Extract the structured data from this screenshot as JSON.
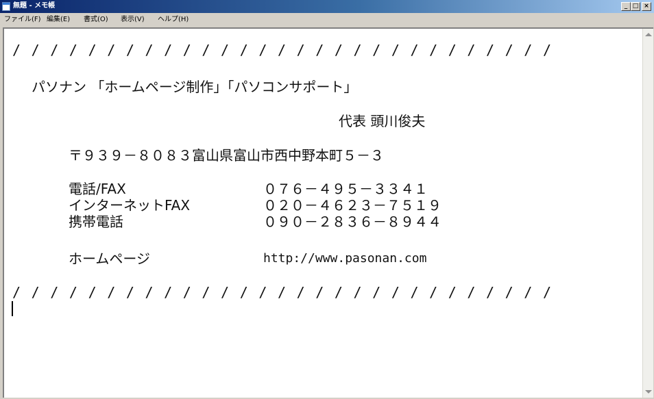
{
  "window": {
    "title": "無題 - メモ帳",
    "buttons": {
      "minimize": "_",
      "maximize": "□",
      "close": "×"
    }
  },
  "menu": [
    "ファイル(F)",
    "編集(E)",
    "書式(O)",
    "表示(V)",
    "ヘルプ(H)"
  ],
  "document": {
    "divider": "/////////////////////////////",
    "heading": "パソナン 「ホームページ制作」「パソコンサポート」",
    "representative": "代表 頭川俊夫",
    "address": "〒９３９－８０８３富山県富山市西中野本町５－３",
    "contacts": [
      {
        "label": "電話/FAX",
        "value": "０７６－４９５－３３４１"
      },
      {
        "label": "インターネットFAX",
        "value": "０２０－４６２３－７５１９"
      },
      {
        "label": "携帯電話",
        "value": "０９０－２８３６－８９４４"
      }
    ],
    "homepage_label": "ホームページ",
    "homepage_url": "http://www.pasonan.com",
    "divider_bottom": "/////////////////////////////"
  }
}
